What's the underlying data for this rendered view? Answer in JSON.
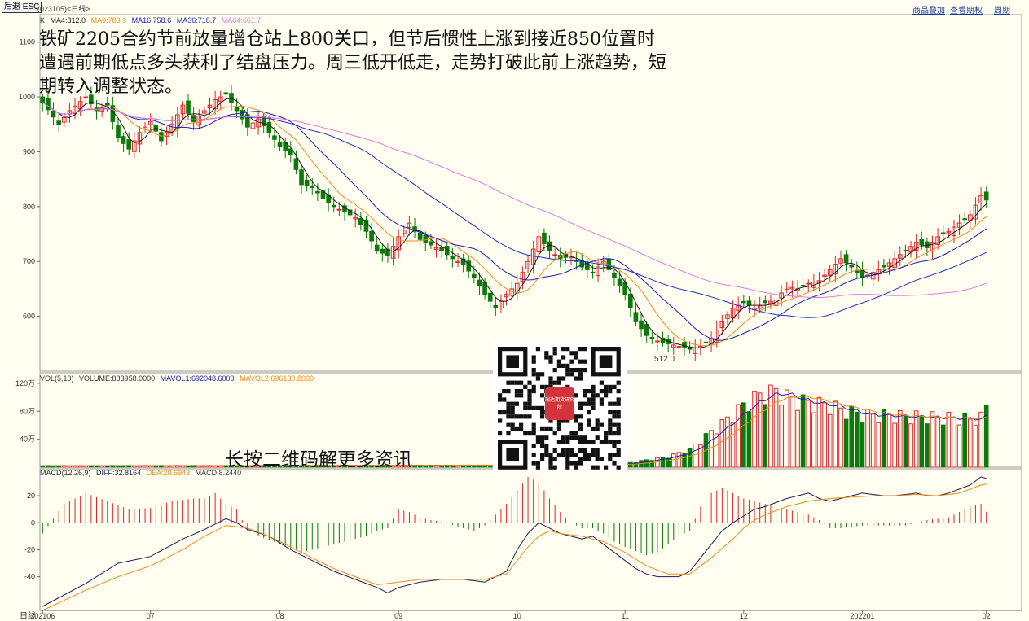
{
  "header": {
    "back_button": "后退 ESC",
    "code_label": "(023105)<日线>",
    "menu": [
      "商品叠加",
      "查看期权",
      "周期"
    ]
  },
  "annotation": {
    "text": "铁矿2205合约节前放量增仓站上800关口，但节后惯性上涨到接近850位置时遭遇前期低点多头获利了结盘压力。周三低开低走，走势打破此前上涨趋势，短期转入调整状态。",
    "qr_caption": "长按二维码解更多资讯",
    "qr_logo_text": "瑞达期货研究院"
  },
  "colors": {
    "background": "#fffef0",
    "up": "#e0242b",
    "down": "#0a7a0a",
    "ma4": "#1a1a1a",
    "ma9": "#f08c1a",
    "ma16": "#1c1cb3",
    "ma36": "#2030d0",
    "ma64": "#e07ae0",
    "axis": "#666666",
    "grid": "#d8d8c8"
  },
  "chart_data": [
    {
      "type": "candlestick",
      "name": "K",
      "legend": [
        {
          "label": "K",
          "color": "#333333"
        },
        {
          "label": "MA4:812.0",
          "color": "#1a1a1a"
        },
        {
          "label": "MA9:783.9",
          "color": "#f08c1a"
        },
        {
          "label": "MA16:758.6",
          "color": "#1c1cb3"
        },
        {
          "label": "MA36:718.7",
          "color": "#2030d0"
        },
        {
          "label": "MA64:661.7",
          "color": "#e07ae0"
        }
      ],
      "y_ticks": [
        600,
        700,
        800,
        900,
        1000,
        1100
      ],
      "ylim": [
        500,
        1150
      ],
      "x_ticks": [
        {
          "i": 0,
          "label": "202106"
        },
        {
          "i": 20,
          "label": "07"
        },
        {
          "i": 44,
          "label": "08"
        },
        {
          "i": 66,
          "label": "09"
        },
        {
          "i": 88,
          "label": "10"
        },
        {
          "i": 108,
          "label": "11"
        },
        {
          "i": 130,
          "label": "12"
        },
        {
          "i": 152,
          "label": "202201"
        },
        {
          "i": 175,
          "label": "02"
        }
      ],
      "n_bars": 176,
      "close_anchors": [
        [
          0,
          990
        ],
        [
          3,
          950
        ],
        [
          5,
          975
        ],
        [
          8,
          1000
        ],
        [
          10,
          975
        ],
        [
          12,
          985
        ],
        [
          14,
          925
        ],
        [
          16,
          905
        ],
        [
          18,
          935
        ],
        [
          20,
          955
        ],
        [
          22,
          920
        ],
        [
          24,
          950
        ],
        [
          26,
          985
        ],
        [
          28,
          955
        ],
        [
          30,
          975
        ],
        [
          32,
          995
        ],
        [
          34,
          1005
        ],
        [
          36,
          975
        ],
        [
          38,
          945
        ],
        [
          40,
          960
        ],
        [
          42,
          935
        ],
        [
          44,
          910
        ],
        [
          46,
          895
        ],
        [
          48,
          840
        ],
        [
          50,
          835
        ],
        [
          52,
          815
        ],
        [
          54,
          800
        ],
        [
          56,
          790
        ],
        [
          58,
          780
        ],
        [
          60,
          755
        ],
        [
          62,
          720
        ],
        [
          64,
          710
        ],
        [
          66,
          745
        ],
        [
          68,
          770
        ],
        [
          70,
          740
        ],
        [
          72,
          730
        ],
        [
          74,
          720
        ],
        [
          76,
          705
        ],
        [
          78,
          695
        ],
        [
          80,
          670
        ],
        [
          82,
          640
        ],
        [
          84,
          615
        ],
        [
          86,
          640
        ],
        [
          88,
          660
        ],
        [
          90,
          700
        ],
        [
          92,
          745
        ],
        [
          94,
          720
        ],
        [
          96,
          705
        ],
        [
          98,
          710
        ],
        [
          100,
          690
        ],
        [
          102,
          680
        ],
        [
          104,
          700
        ],
        [
          106,
          670
        ],
        [
          108,
          640
        ],
        [
          110,
          590
        ],
        [
          112,
          565
        ],
        [
          114,
          555
        ],
        [
          116,
          550
        ],
        [
          118,
          545
        ],
        [
          120,
          540
        ],
        [
          122,
          545
        ],
        [
          124,
          560
        ],
        [
          126,
          590
        ],
        [
          128,
          615
        ],
        [
          130,
          625
        ],
        [
          132,
          615
        ],
        [
          134,
          625
        ],
        [
          136,
          630
        ],
        [
          138,
          655
        ],
        [
          140,
          650
        ],
        [
          142,
          660
        ],
        [
          144,
          665
        ],
        [
          146,
          685
        ],
        [
          148,
          705
        ],
        [
          150,
          690
        ],
        [
          152,
          670
        ],
        [
          154,
          680
        ],
        [
          156,
          690
        ],
        [
          158,
          705
        ],
        [
          160,
          720
        ],
        [
          162,
          735
        ],
        [
          164,
          725
        ],
        [
          166,
          745
        ],
        [
          168,
          755
        ],
        [
          170,
          770
        ],
        [
          172,
          785
        ],
        [
          174,
          820
        ],
        [
          175,
          812
        ]
      ],
      "ma4": 812.0,
      "ma9": 783.9,
      "ma16": 758.6,
      "ma36": 718.7,
      "ma64": 661.7,
      "low_annotation": {
        "index": 118,
        "label": "512.0"
      }
    },
    {
      "type": "bar",
      "name": "VOL(5,10)",
      "legend": [
        {
          "label": "VOL(5,10)",
          "color": "#333333"
        },
        {
          "label": "VOLUME:883958.0000",
          "color": "#333333"
        },
        {
          "label": "MAVOL1:692048.6000",
          "color": "#1c1cb3"
        },
        {
          "label": "MAVOL2:696180.8000",
          "color": "#f08c1a"
        }
      ],
      "y_ticks": [
        {
          "value": 40,
          "label": "40万"
        },
        {
          "value": 80,
          "label": "80万"
        },
        {
          "value": 120,
          "label": "120万"
        }
      ],
      "ylim": [
        0,
        135
      ],
      "unit": "万",
      "volume_anchors": [
        [
          0,
          2
        ],
        [
          100,
          3
        ],
        [
          108,
          5
        ],
        [
          112,
          10
        ],
        [
          116,
          15
        ],
        [
          118,
          20
        ],
        [
          120,
          25
        ],
        [
          122,
          38
        ],
        [
          124,
          50
        ],
        [
          126,
          62
        ],
        [
          128,
          75
        ],
        [
          130,
          88
        ],
        [
          132,
          98
        ],
        [
          134,
          105
        ],
        [
          136,
          108
        ],
        [
          138,
          100
        ],
        [
          140,
          95
        ],
        [
          142,
          92
        ],
        [
          144,
          90
        ],
        [
          146,
          88
        ],
        [
          148,
          82
        ],
        [
          150,
          78
        ],
        [
          152,
          75
        ],
        [
          154,
          74
        ],
        [
          156,
          74
        ],
        [
          158,
          73
        ],
        [
          160,
          72
        ],
        [
          162,
          72
        ],
        [
          164,
          72
        ],
        [
          166,
          70
        ],
        [
          168,
          70
        ],
        [
          170,
          70
        ],
        [
          172,
          68
        ],
        [
          174,
          70
        ],
        [
          175,
          88
        ]
      ]
    },
    {
      "type": "line",
      "name": "MACD(12,26,9)",
      "legend": [
        {
          "label": "MACD(12,26,9)",
          "color": "#333333"
        },
        {
          "label": "DIFF:32.8164",
          "color": "#1c1c5a"
        },
        {
          "label": "DEA:28.6943",
          "color": "#f08c1a"
        },
        {
          "label": "MACD:8.2440",
          "color": "#333333"
        }
      ],
      "y_ticks": [
        -40,
        -20,
        0,
        20
      ],
      "ylim": [
        -65,
        40
      ],
      "diff_anchors": [
        [
          0,
          -62
        ],
        [
          8,
          -45
        ],
        [
          14,
          -30
        ],
        [
          20,
          -25
        ],
        [
          26,
          -12
        ],
        [
          30,
          -5
        ],
        [
          34,
          3
        ],
        [
          36,
          0
        ],
        [
          38,
          -5
        ],
        [
          42,
          -10
        ],
        [
          46,
          -20
        ],
        [
          50,
          -28
        ],
        [
          54,
          -36
        ],
        [
          58,
          -42
        ],
        [
          62,
          -48
        ],
        [
          64,
          -52
        ],
        [
          66,
          -48
        ],
        [
          70,
          -44
        ],
        [
          74,
          -42
        ],
        [
          78,
          -42
        ],
        [
          82,
          -44
        ],
        [
          84,
          -40
        ],
        [
          86,
          -36
        ],
        [
          88,
          -20
        ],
        [
          90,
          -8
        ],
        [
          92,
          0
        ],
        [
          94,
          -4
        ],
        [
          96,
          -8
        ],
        [
          98,
          -10
        ],
        [
          100,
          -12
        ],
        [
          102,
          -10
        ],
        [
          104,
          -16
        ],
        [
          106,
          -22
        ],
        [
          108,
          -28
        ],
        [
          110,
          -34
        ],
        [
          112,
          -38
        ],
        [
          114,
          -40
        ],
        [
          116,
          -40
        ],
        [
          118,
          -40
        ],
        [
          120,
          -36
        ],
        [
          122,
          -26
        ],
        [
          124,
          -16
        ],
        [
          126,
          -6
        ],
        [
          128,
          0
        ],
        [
          130,
          5
        ],
        [
          132,
          10
        ],
        [
          134,
          12
        ],
        [
          136,
          15
        ],
        [
          138,
          18
        ],
        [
          140,
          20
        ],
        [
          142,
          22
        ],
        [
          144,
          18
        ],
        [
          146,
          16
        ],
        [
          148,
          18
        ],
        [
          150,
          20
        ],
        [
          152,
          22
        ],
        [
          154,
          21
        ],
        [
          156,
          20
        ],
        [
          158,
          20
        ],
        [
          160,
          21
        ],
        [
          162,
          22
        ],
        [
          164,
          20
        ],
        [
          166,
          20
        ],
        [
          168,
          22
        ],
        [
          170,
          25
        ],
        [
          172,
          28
        ],
        [
          174,
          34
        ],
        [
          175,
          32.8
        ]
      ],
      "dea_anchors": [
        [
          0,
          -65
        ],
        [
          8,
          -50
        ],
        [
          14,
          -40
        ],
        [
          20,
          -32
        ],
        [
          26,
          -20
        ],
        [
          30,
          -10
        ],
        [
          34,
          -2
        ],
        [
          38,
          -4
        ],
        [
          42,
          -10
        ],
        [
          46,
          -18
        ],
        [
          50,
          -26
        ],
        [
          54,
          -34
        ],
        [
          58,
          -40
        ],
        [
          62,
          -46
        ],
        [
          66,
          -44
        ],
        [
          70,
          -42
        ],
        [
          74,
          -42
        ],
        [
          78,
          -42
        ],
        [
          82,
          -42
        ],
        [
          86,
          -38
        ],
        [
          88,
          -28
        ],
        [
          90,
          -18
        ],
        [
          92,
          -10
        ],
        [
          94,
          -6
        ],
        [
          96,
          -8
        ],
        [
          98,
          -9
        ],
        [
          100,
          -10
        ],
        [
          104,
          -14
        ],
        [
          108,
          -22
        ],
        [
          112,
          -32
        ],
        [
          116,
          -38
        ],
        [
          120,
          -38
        ],
        [
          124,
          -26
        ],
        [
          128,
          -12
        ],
        [
          130,
          -4
        ],
        [
          132,
          2
        ],
        [
          134,
          6
        ],
        [
          138,
          12
        ],
        [
          142,
          16
        ],
        [
          146,
          18
        ],
        [
          150,
          19
        ],
        [
          154,
          20
        ],
        [
          158,
          20
        ],
        [
          162,
          21
        ],
        [
          166,
          20
        ],
        [
          170,
          22
        ],
        [
          174,
          28
        ],
        [
          175,
          28.7
        ]
      ],
      "macd_anchors": [
        [
          0,
          -8
        ],
        [
          4,
          14
        ],
        [
          8,
          22
        ],
        [
          12,
          16
        ],
        [
          16,
          10
        ],
        [
          20,
          11
        ],
        [
          24,
          16
        ],
        [
          28,
          18
        ],
        [
          30,
          18
        ],
        [
          32,
          22
        ],
        [
          34,
          14
        ],
        [
          36,
          10
        ],
        [
          38,
          -6
        ],
        [
          40,
          -10
        ],
        [
          44,
          -16
        ],
        [
          48,
          -22
        ],
        [
          52,
          -18
        ],
        [
          56,
          -14
        ],
        [
          60,
          -10
        ],
        [
          62,
          -6
        ],
        [
          64,
          -4
        ],
        [
          66,
          10
        ],
        [
          68,
          8
        ],
        [
          70,
          4
        ],
        [
          72,
          2
        ],
        [
          74,
          1
        ],
        [
          78,
          -4
        ],
        [
          80,
          -6
        ],
        [
          82,
          -2
        ],
        [
          84,
          6
        ],
        [
          86,
          14
        ],
        [
          88,
          24
        ],
        [
          90,
          34
        ],
        [
          92,
          30
        ],
        [
          94,
          18
        ],
        [
          96,
          8
        ],
        [
          98,
          0
        ],
        [
          100,
          -4
        ],
        [
          102,
          -4
        ],
        [
          104,
          -8
        ],
        [
          106,
          -14
        ],
        [
          108,
          -18
        ],
        [
          112,
          -24
        ],
        [
          114,
          -22
        ],
        [
          116,
          -16
        ],
        [
          118,
          -10
        ],
        [
          120,
          -6
        ],
        [
          122,
          12
        ],
        [
          124,
          22
        ],
        [
          126,
          26
        ],
        [
          128,
          22
        ],
        [
          130,
          18
        ],
        [
          134,
          14
        ],
        [
          138,
          10
        ],
        [
          142,
          6
        ],
        [
          144,
          2
        ],
        [
          146,
          -4
        ],
        [
          148,
          -4
        ],
        [
          152,
          -2
        ],
        [
          156,
          -2
        ],
        [
          160,
          -2
        ],
        [
          164,
          2
        ],
        [
          168,
          4
        ],
        [
          172,
          12
        ],
        [
          174,
          14
        ],
        [
          175,
          8.2
        ]
      ]
    }
  ]
}
